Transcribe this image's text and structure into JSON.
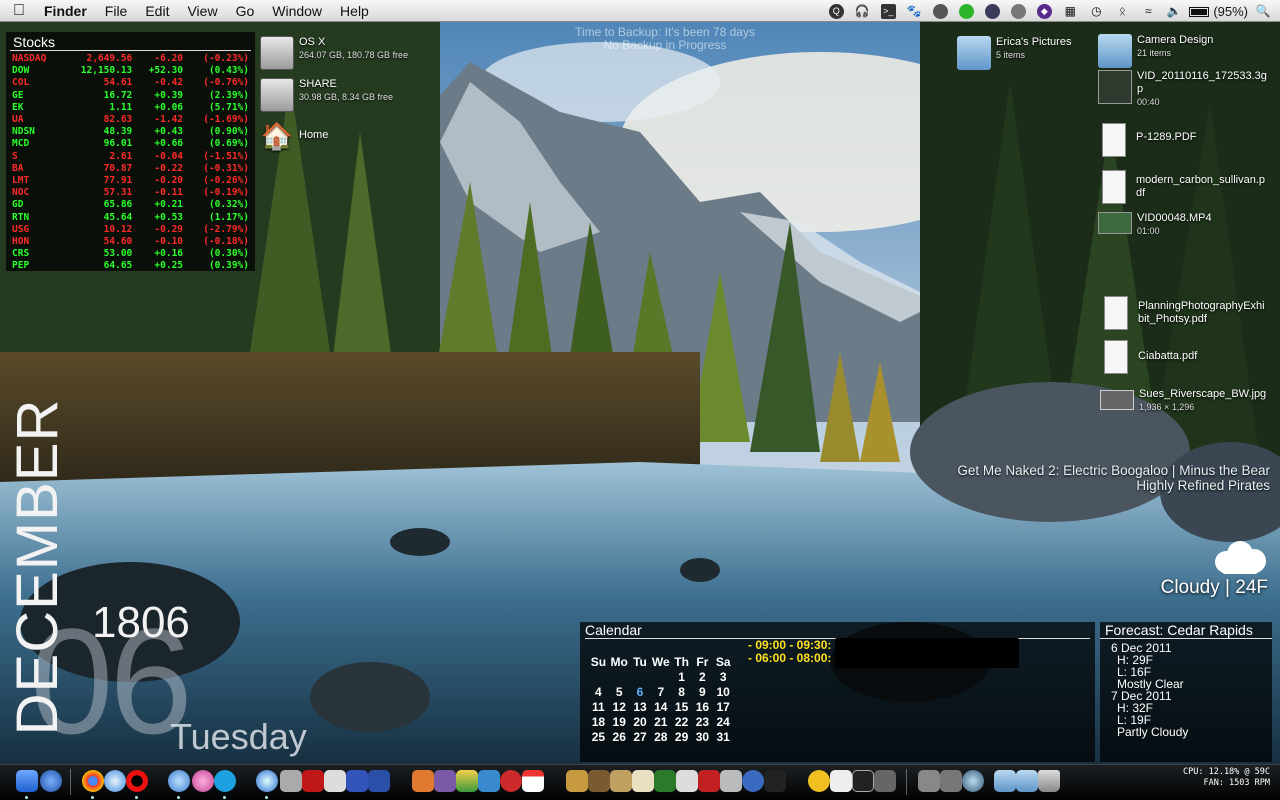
{
  "menubar": {
    "app_name": "Finder",
    "menus": [
      "File",
      "Edit",
      "View",
      "Go",
      "Window",
      "Help"
    ],
    "status_icons": [
      "quicksilver-icon",
      "headphones-icon",
      "terminal-icon",
      "growl-paw-icon",
      "cat-icon",
      "green-status-icon",
      "istat-icon",
      "time-machine-icon",
      "purple-app-icon",
      "dropbox-icon",
      "backup-clock-icon",
      "bluetooth-icon",
      "wifi-icon",
      "volume-icon",
      "battery-icon",
      "spotlight-icon"
    ],
    "battery_text": "(95%)"
  },
  "stocks": {
    "title": "Stocks",
    "rows": [
      {
        "symbol": "NASDAQ",
        "price": "2,649.56",
        "change": "-6.20",
        "pct": "(-0.23%)",
        "dir": "down"
      },
      {
        "symbol": "DOW",
        "price": "12,150.13",
        "change": "+52.30",
        "pct": "(0.43%)",
        "dir": "up"
      },
      {
        "symbol": "COL",
        "price": "54.61",
        "change": "-0.42",
        "pct": "(-0.76%)",
        "dir": "down"
      },
      {
        "symbol": "GE",
        "price": "16.72",
        "change": "+0.39",
        "pct": "(2.39%)",
        "dir": "up"
      },
      {
        "symbol": "EK",
        "price": "1.11",
        "change": "+0.06",
        "pct": "(5.71%)",
        "dir": "up"
      },
      {
        "symbol": "UA",
        "price": "82.63",
        "change": "-1.42",
        "pct": "(-1.69%)",
        "dir": "down"
      },
      {
        "symbol": "NDSN",
        "price": "48.39",
        "change": "+0.43",
        "pct": "(0.90%)",
        "dir": "up"
      },
      {
        "symbol": "MCD",
        "price": "96.01",
        "change": "+0.66",
        "pct": "(0.69%)",
        "dir": "up"
      },
      {
        "symbol": "S",
        "price": "2.61",
        "change": "-0.04",
        "pct": "(-1.51%)",
        "dir": "down"
      },
      {
        "symbol": "BA",
        "price": "70.87",
        "change": "-0.22",
        "pct": "(-0.31%)",
        "dir": "down"
      },
      {
        "symbol": "LMT",
        "price": "77.91",
        "change": "-0.20",
        "pct": "(-0.26%)",
        "dir": "down"
      },
      {
        "symbol": "NOC",
        "price": "57.31",
        "change": "-0.11",
        "pct": "(-0.19%)",
        "dir": "down"
      },
      {
        "symbol": "GD",
        "price": "65.86",
        "change": "+0.21",
        "pct": "(0.32%)",
        "dir": "up"
      },
      {
        "symbol": "RTN",
        "price": "45.64",
        "change": "+0.53",
        "pct": "(1.17%)",
        "dir": "up"
      },
      {
        "symbol": "USG",
        "price": "10.12",
        "change": "-0.29",
        "pct": "(-2.79%)",
        "dir": "down"
      },
      {
        "symbol": "HON",
        "price": "54.60",
        "change": "-0.10",
        "pct": "(-0.18%)",
        "dir": "down"
      },
      {
        "symbol": "CRS",
        "price": "53.00",
        "change": "+0.16",
        "pct": "(0.30%)",
        "dir": "up"
      },
      {
        "symbol": "PEP",
        "price": "64.65",
        "change": "+0.25",
        "pct": "(0.39%)",
        "dir": "up"
      }
    ]
  },
  "drives": [
    {
      "name": "OS X",
      "info": "264.07 GB, 180.78 GB free"
    },
    {
      "name": "SHARE",
      "info": "30.98 GB, 8.34 GB free"
    },
    {
      "name": "Home",
      "info": ""
    }
  ],
  "backup": {
    "line1": "Time to Backup: It's been 78 days",
    "line2": "No Backup in Progress"
  },
  "desktop_files": [
    {
      "name": "Erica's Pictures",
      "info": "5 items",
      "kind": "folder"
    },
    {
      "name": "Camera Design",
      "info": "21 items",
      "kind": "folder"
    },
    {
      "name": "VID_20110116_172533.3gp",
      "info": "00:40",
      "kind": "video"
    },
    {
      "name": "P-1289.PDF",
      "info": "",
      "kind": "pdf"
    },
    {
      "name": "modern_carbon_sullivan.pdf",
      "info": "",
      "kind": "pdf"
    },
    {
      "name": "VID00048.MP4",
      "info": "01:00",
      "kind": "video"
    },
    {
      "name": "PlanningPhotographyExhibit_Photsy.pdf",
      "info": "",
      "kind": "pdf"
    },
    {
      "name": "Ciabatta.pdf",
      "info": "",
      "kind": "pdf"
    },
    {
      "name": "Sues_Riverscape_BW.jpg",
      "info": "1,936 × 1,296",
      "kind": "image"
    }
  ],
  "now_playing": {
    "line1": "Get Me Naked 2: Electric Boogaloo | Minus the Bear",
    "line2": "Highly Refined Pirates"
  },
  "weather": {
    "text": "Cloudy | 24F",
    "icon": "cloud-icon"
  },
  "date": {
    "month": "DECEMBER",
    "day": "06",
    "year": "1806",
    "weekday": "Tuesday"
  },
  "calendar": {
    "title": "Calendar",
    "weekdays": [
      "Su",
      "Mo",
      "Tu",
      "We",
      "Th",
      "Fr",
      "Sa"
    ],
    "weeks": [
      [
        "",
        "",
        "",
        "",
        "1",
        "2",
        "3"
      ],
      [
        "4",
        "5",
        "6",
        "7",
        "8",
        "9",
        "10"
      ],
      [
        "11",
        "12",
        "13",
        "14",
        "15",
        "16",
        "17"
      ],
      [
        "18",
        "19",
        "20",
        "21",
        "22",
        "23",
        "24"
      ],
      [
        "25",
        "26",
        "27",
        "28",
        "29",
        "30",
        "31"
      ]
    ],
    "today": "6",
    "events": [
      "- 09:00 - 09:30:",
      "- 06:00 - 08:00:"
    ]
  },
  "forecast": {
    "title": "Forecast: Cedar Rapids",
    "days": [
      {
        "date": "6 Dec 2011",
        "high": "H: 29F",
        "low": "L: 16F",
        "cond": "Mostly Clear"
      },
      {
        "date": "7 Dec 2011",
        "high": "H: 32F",
        "low": "L: 19F",
        "cond": "Partly Cloudy"
      }
    ]
  },
  "system_monitor": {
    "line1": "CPU: 12.18% @ 59C",
    "line2": "FAN: 1503 RPM"
  },
  "colors": {
    "stock_up": "#2cff2c",
    "stock_down": "#ff2a2a",
    "event_yellow": "#ffe020",
    "today_blue": "#5fb3ff"
  }
}
